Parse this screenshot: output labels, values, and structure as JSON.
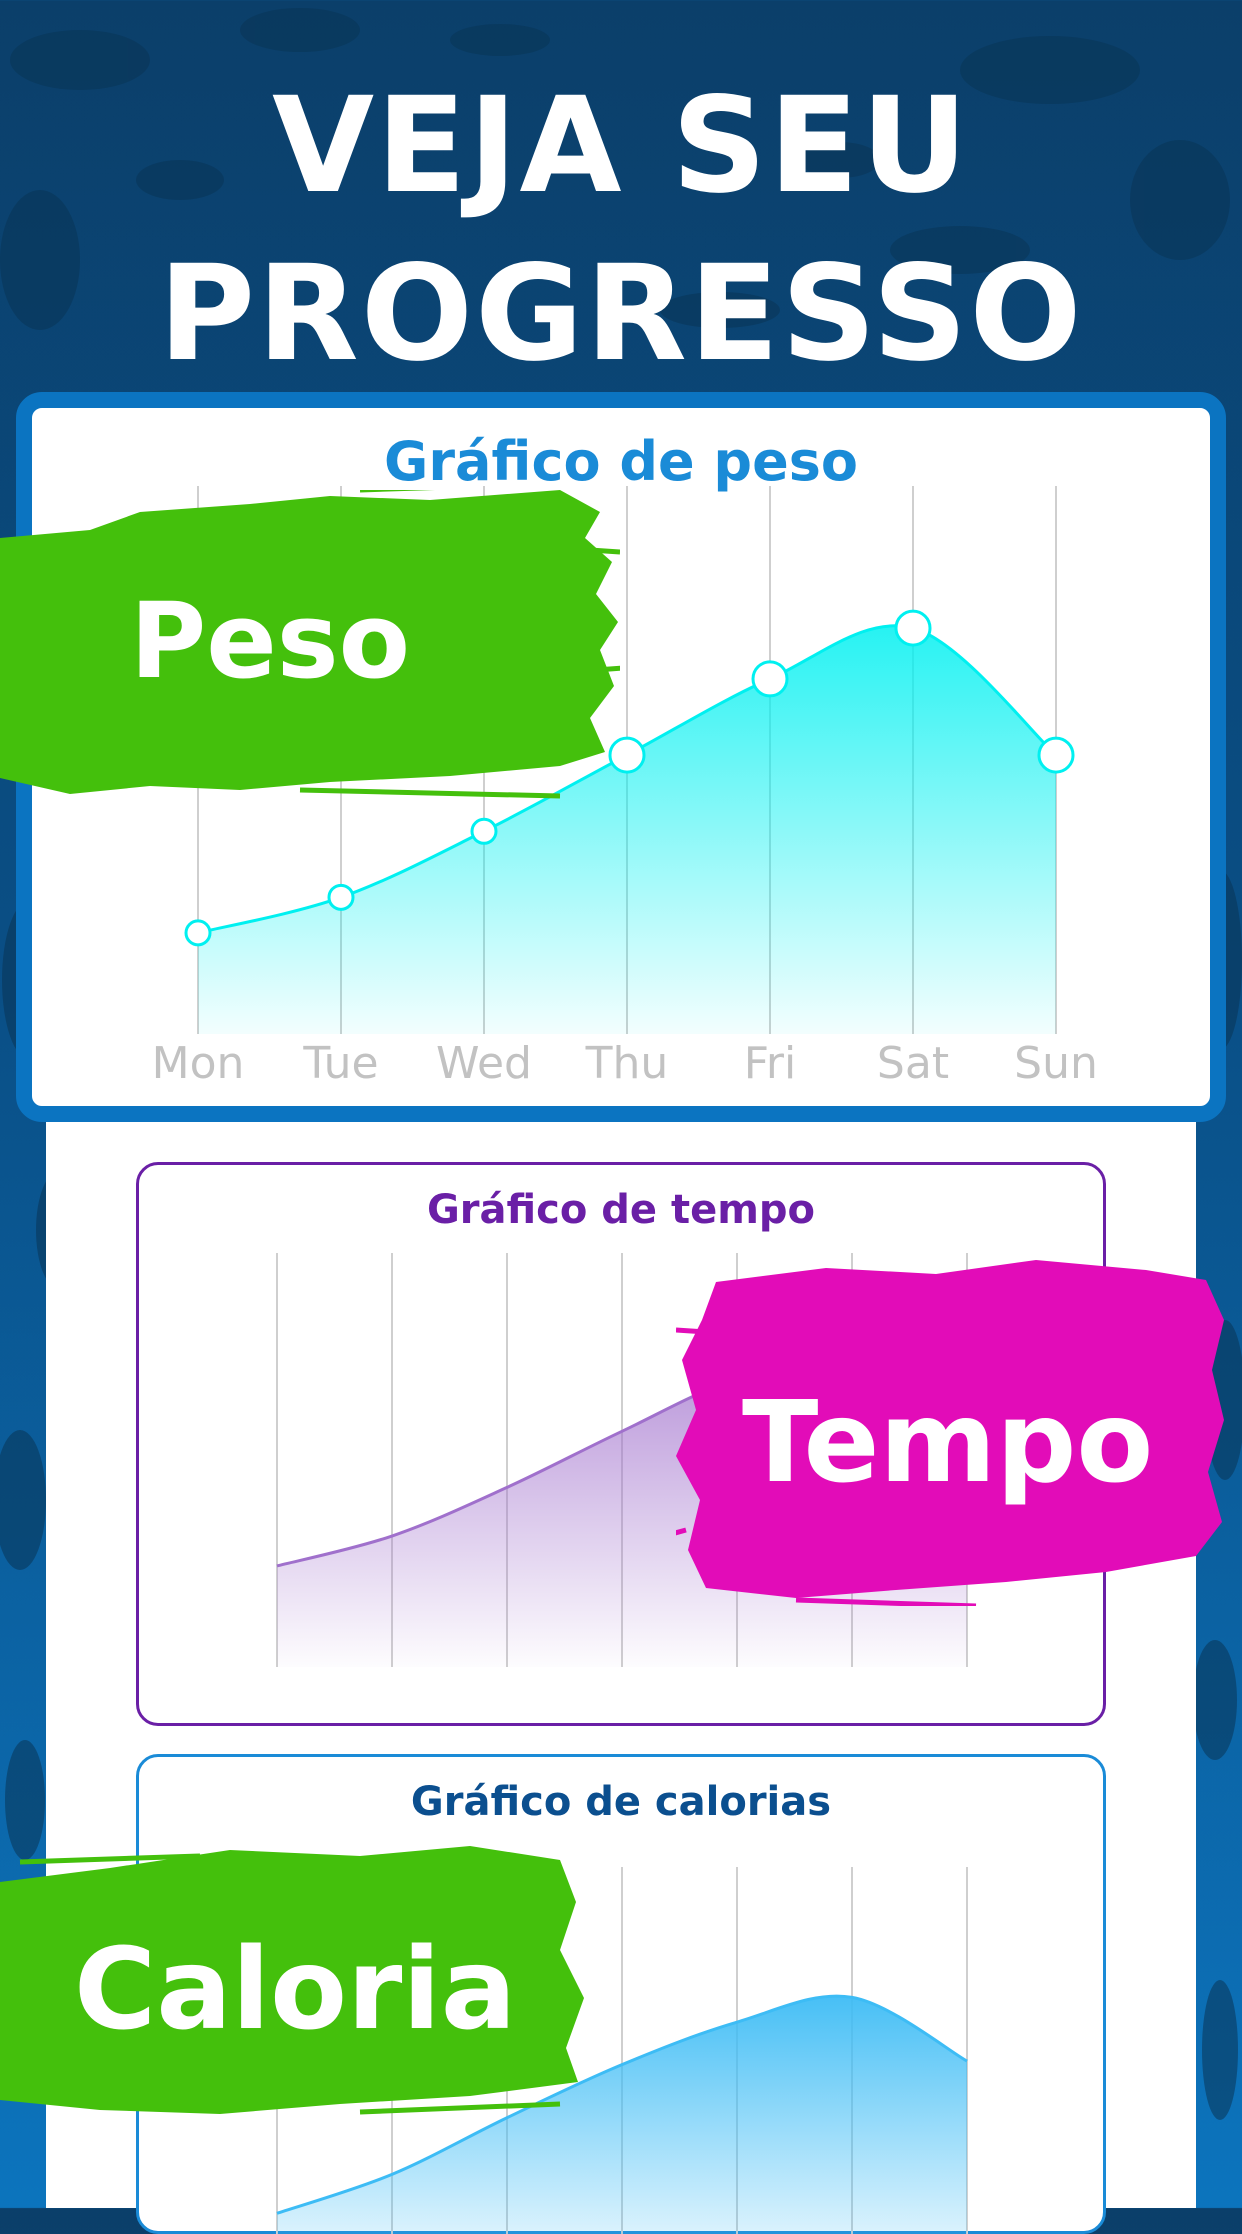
{
  "headline": [
    "VEJA SEU",
    "PROGRESSO"
  ],
  "colors": {
    "background": "#0a4f86",
    "peso_line": "#00f0f0",
    "tempo_line": "#a070cc",
    "calorias_line": "#3dbcf5",
    "brush_green": "#44c00c",
    "brush_magenta": "#e20cb8"
  },
  "tags": {
    "peso": "Peso",
    "tempo": "Tempo",
    "calorias": "Caloria"
  },
  "chart_data": [
    {
      "type": "area",
      "title": "Gráfico de peso",
      "categories": [
        "Mon",
        "Tue",
        "Wed",
        "Thu",
        "Fri",
        "Sat",
        "Sun"
      ],
      "values": [
        14,
        21,
        34,
        49,
        64,
        74,
        49
      ],
      "ylim": [
        0,
        100
      ],
      "grid": "vertical",
      "markers": true
    },
    {
      "type": "area",
      "title": "Gráfico de tempo",
      "categories": [
        "",
        "",
        "",
        "",
        "",
        "",
        ""
      ],
      "values": [
        19,
        27,
        40,
        55,
        69,
        74,
        54
      ],
      "ylim": [
        0,
        100
      ],
      "grid": "vertical",
      "markers": false
    },
    {
      "type": "area",
      "title": "Gráfico de calorias",
      "categories": [
        "",
        "",
        "",
        "",
        "",
        "",
        ""
      ],
      "values": [
        5,
        16,
        32,
        47,
        59,
        66,
        48
      ],
      "ylim": [
        0,
        100
      ],
      "grid": "vertical",
      "markers": false
    }
  ]
}
